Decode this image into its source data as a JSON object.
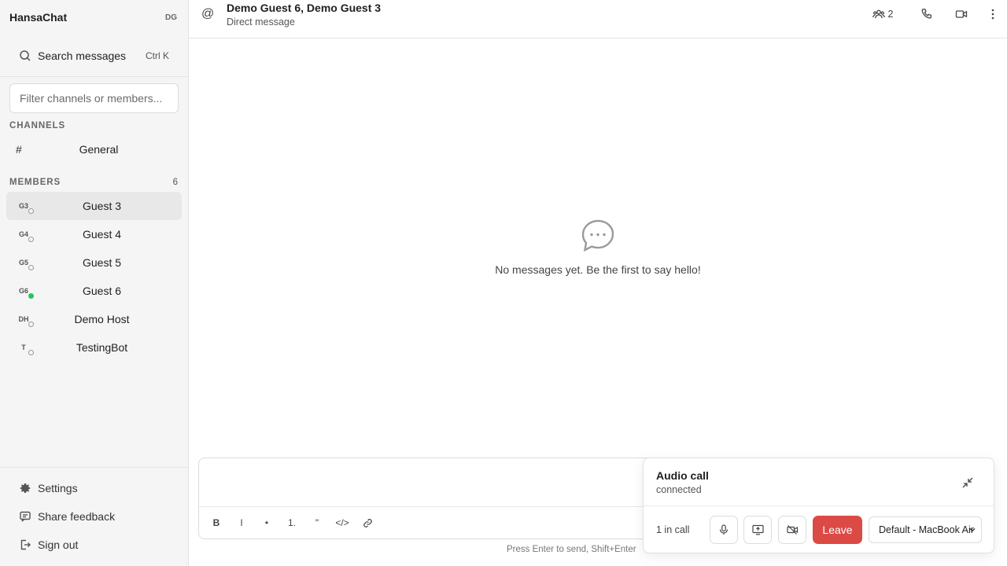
{
  "app": {
    "brand": "HansaChat",
    "user_initials": "DG"
  },
  "search": {
    "label": "Search messages",
    "shortcut": "Ctrl K"
  },
  "filter": {
    "placeholder": "Filter channels or members..."
  },
  "channels": {
    "heading": "CHANNELS",
    "items": [
      {
        "prefix": "#",
        "label": "General"
      }
    ]
  },
  "members": {
    "heading": "MEMBERS",
    "count": "6",
    "items": [
      {
        "initials": "G3",
        "name": "Guest 3",
        "status": "offline",
        "active": true
      },
      {
        "initials": "G4",
        "name": "Guest 4",
        "status": "offline"
      },
      {
        "initials": "G5",
        "name": "Guest 5",
        "status": "offline"
      },
      {
        "initials": "G6",
        "name": "Guest 6",
        "status": "online"
      },
      {
        "initials": "DH",
        "name": "Demo Host",
        "status": "offline"
      },
      {
        "initials": "T",
        "name": "TestingBot",
        "status": "offline"
      }
    ]
  },
  "footer": {
    "settings": "Settings",
    "feedback": "Share feedback",
    "signout": "Sign out"
  },
  "header": {
    "title": "Demo Guest 6, Demo Guest 3",
    "subtitle": "Direct message",
    "participants_count": "2"
  },
  "empty_state": {
    "message": "No messages yet. Be the first to say hello!"
  },
  "composer": {
    "format_buttons": [
      "B",
      "I",
      "•",
      "1.",
      "\"",
      "</>"
    ],
    "hint": "Press Enter to send, Shift+Enter"
  },
  "call": {
    "title": "Audio call",
    "status": "connected",
    "participants": "1 in call",
    "leave_label": "Leave",
    "device": "Default - MacBook Air"
  },
  "colors": {
    "leave": "#dc4a46",
    "online": "#22c55e",
    "sidebar_bg": "#f5f5f5"
  }
}
